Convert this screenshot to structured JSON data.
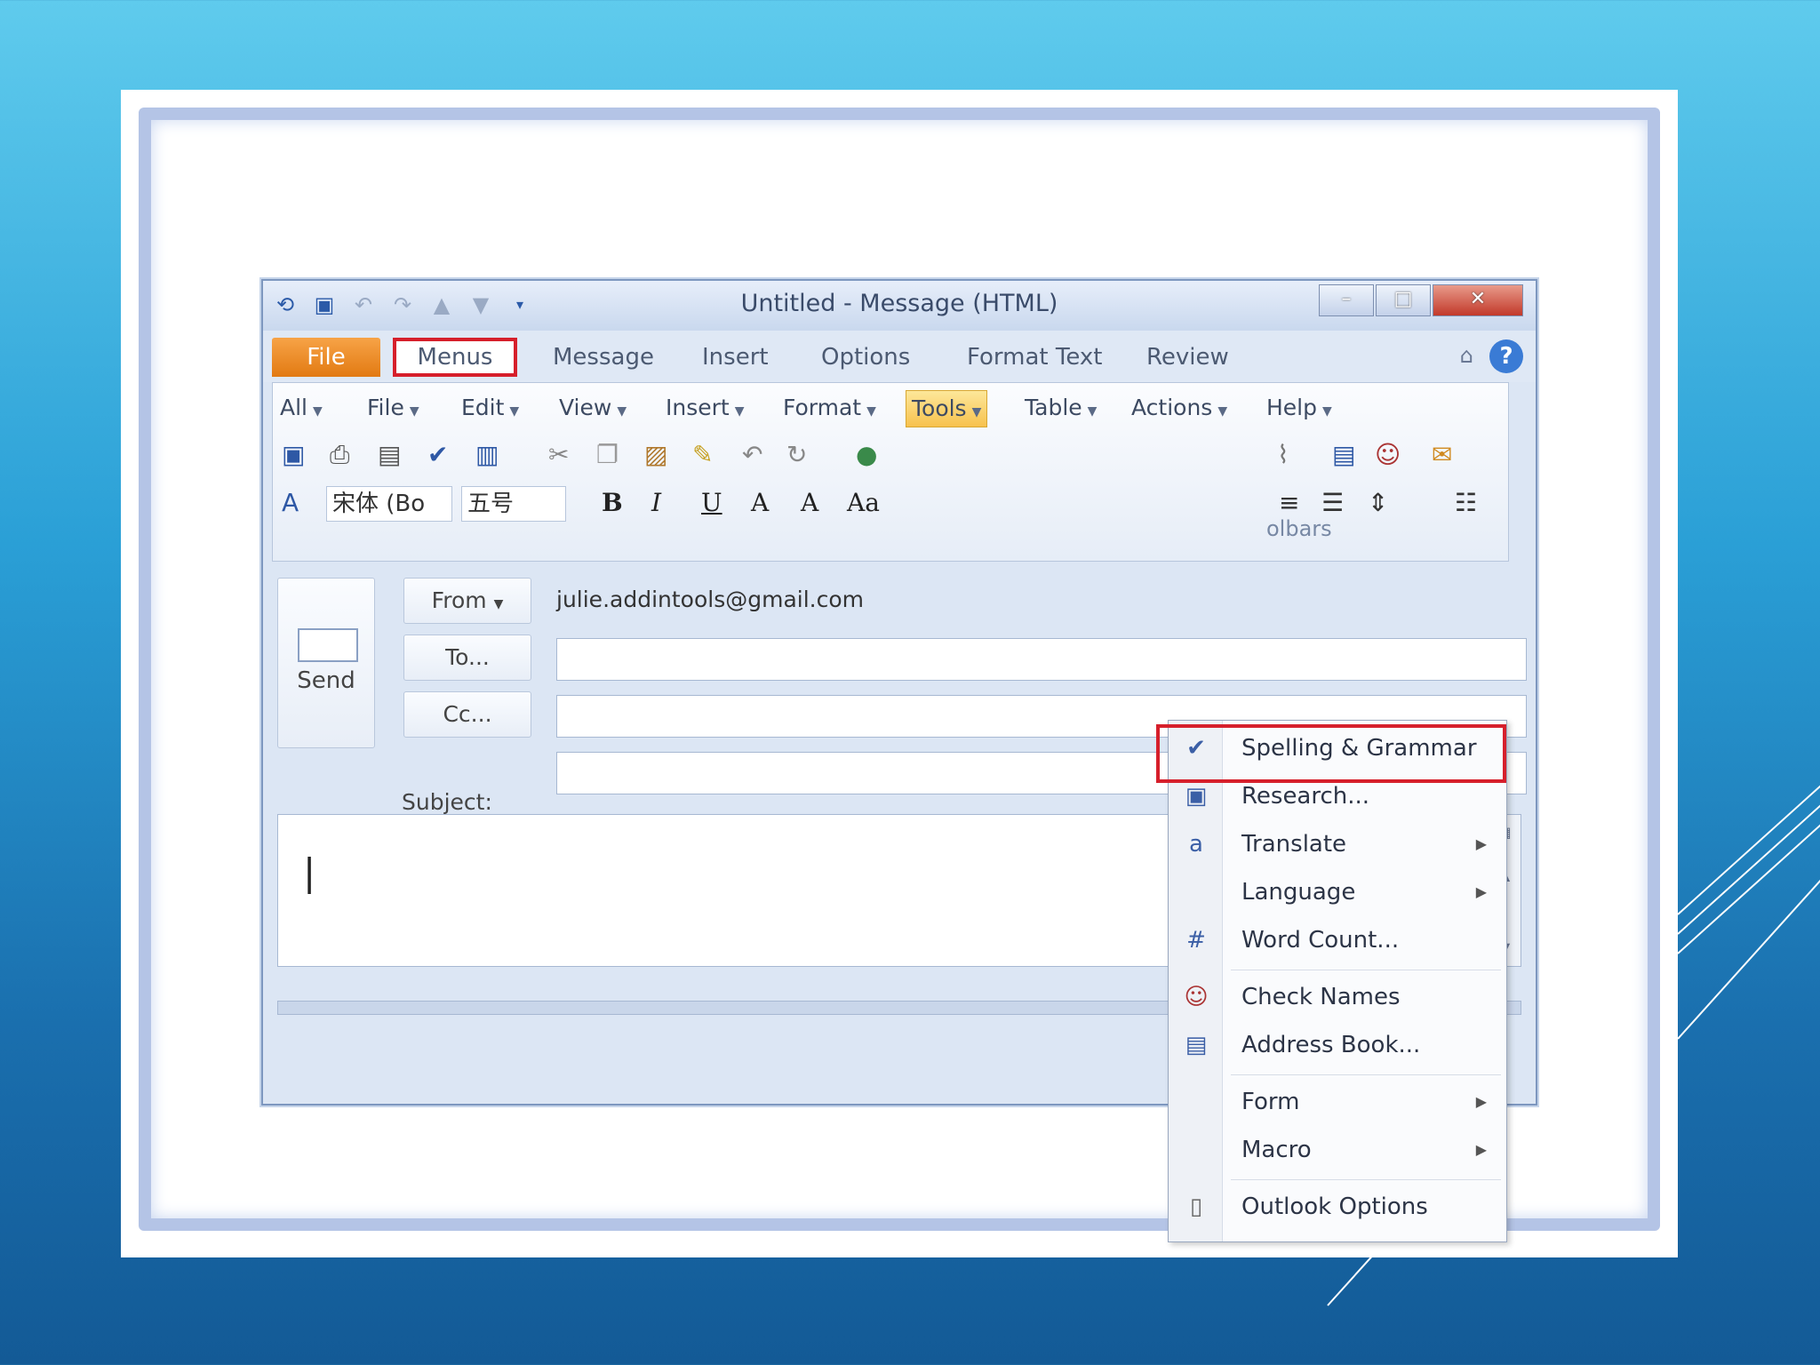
{
  "window": {
    "title": "Untitled  -  Message (HTML)",
    "controls": {
      "minimize": "–",
      "maximize": "□",
      "close": "✕"
    }
  },
  "ribbon_tabs": [
    {
      "label": "File"
    },
    {
      "label": "Menus"
    },
    {
      "label": "Message"
    },
    {
      "label": "Insert"
    },
    {
      "label": "Options"
    },
    {
      "label": "Format Text"
    },
    {
      "label": "Review"
    }
  ],
  "help": {
    "label": "?"
  },
  "classic_menu": [
    {
      "label": "All"
    },
    {
      "label": "File"
    },
    {
      "label": "Edit"
    },
    {
      "label": "View"
    },
    {
      "label": "Insert"
    },
    {
      "label": "Format"
    },
    {
      "label": "Tools"
    },
    {
      "label": "Table"
    },
    {
      "label": "Actions"
    },
    {
      "label": "Help"
    }
  ],
  "font": {
    "name": "宋体 (Bo",
    "size": "五号"
  },
  "format_buttons": {
    "bold": "B",
    "italic": "I",
    "underline": "U",
    "highlight": "A",
    "font_color": "A",
    "change_case": "Aa"
  },
  "group_label": "olbars",
  "compose": {
    "send_label": "Send",
    "from_label": "From",
    "from_value": "julie.addintools@gmail.com",
    "to_label": "To...",
    "cc_label": "Cc...",
    "subject_label": "Subject:",
    "cursor": "|"
  },
  "tools_menu": [
    {
      "label": "Spelling & Grammar",
      "icon": "spelling-icon",
      "glyph": "✔",
      "submenu": false
    },
    {
      "label": "Research...",
      "icon": "research-icon",
      "glyph": "▣",
      "submenu": false
    },
    {
      "label": "Translate",
      "icon": "translate-icon",
      "glyph": "a",
      "submenu": true
    },
    {
      "label": "Language",
      "icon": "",
      "glyph": "",
      "submenu": true
    },
    {
      "label": "Word Count...",
      "icon": "word-count-icon",
      "glyph": "#",
      "submenu": false
    },
    {
      "label": "Check Names",
      "icon": "check-names-icon",
      "glyph": "☺",
      "submenu": false
    },
    {
      "label": "Address Book...",
      "icon": "address-book-icon",
      "glyph": "▤",
      "submenu": false
    },
    {
      "label": "Form",
      "icon": "",
      "glyph": "",
      "submenu": true
    },
    {
      "label": "Macro",
      "icon": "",
      "glyph": "",
      "submenu": true
    },
    {
      "label": "Outlook Options",
      "icon": "options-icon",
      "glyph": "▯",
      "submenu": false
    }
  ],
  "colors": {
    "accent_red": "#d61f2b",
    "file_tab": "#e27a12",
    "tools_highlight": "#f7c24d"
  }
}
